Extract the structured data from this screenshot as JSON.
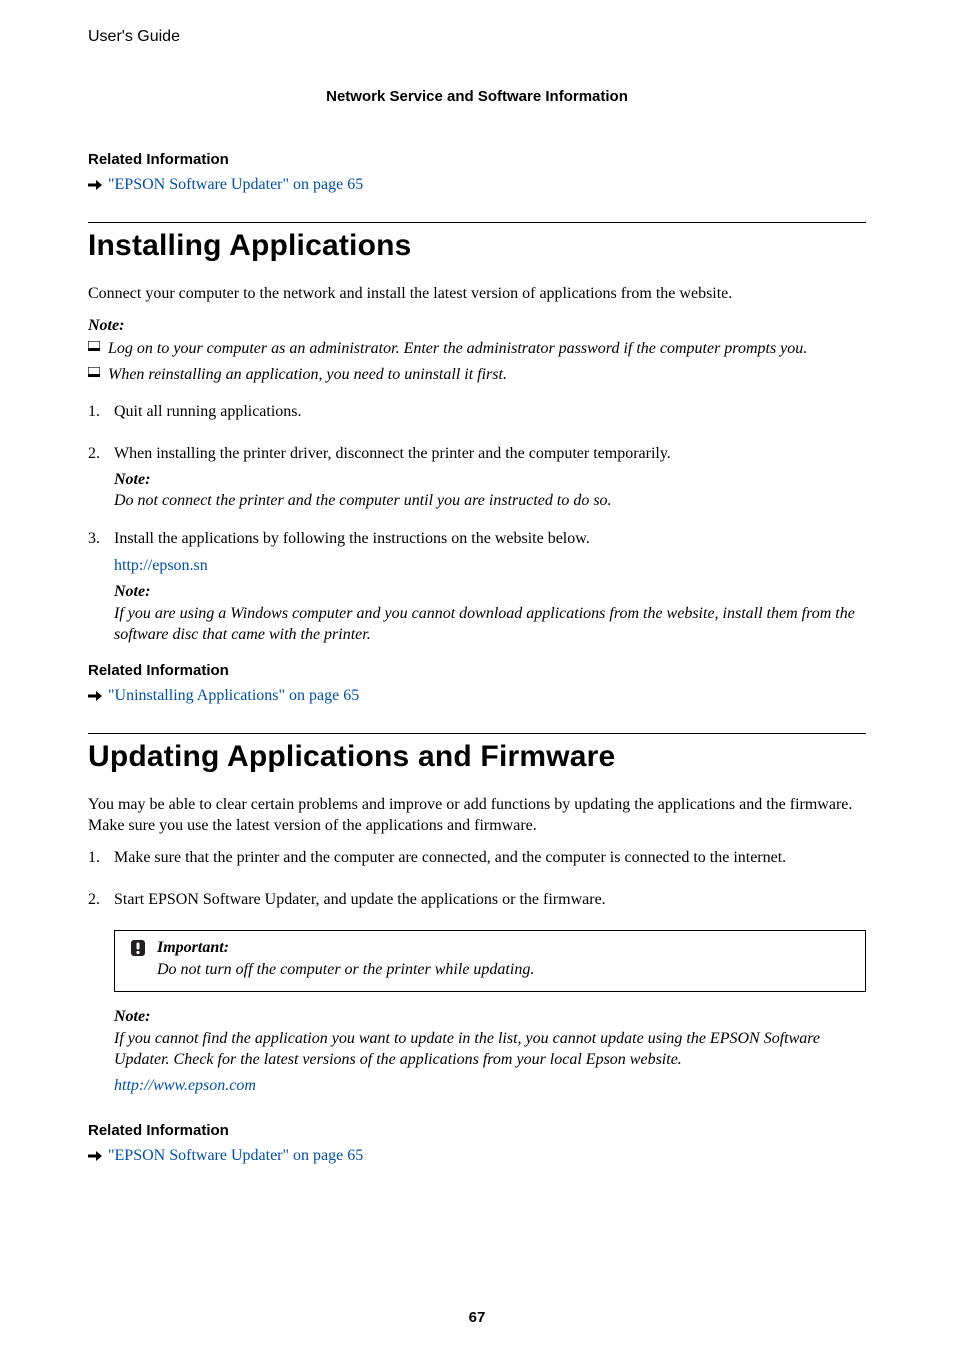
{
  "header": {
    "doc_type": "User's Guide",
    "chapter_title": "Network Service and Software Information"
  },
  "rel_info_label": "Related Information",
  "links": {
    "epson_updater": "\"EPSON Software Updater\" on page 65",
    "uninstalling": "\"Uninstalling Applications\" on page 65",
    "epson_sn": "http://epson.sn",
    "epson_com": "http://www.epson.com"
  },
  "section1": {
    "title": "Installing Applications",
    "intro": "Connect your computer to the network and install the latest version of applications from the website.",
    "note_label": "Note:",
    "bullets": [
      "Log on to your computer as an administrator. Enter the administrator password if the computer prompts you.",
      "When reinstalling an application, you need to uninstall it first."
    ],
    "steps": [
      {
        "text": "Quit all running applications."
      },
      {
        "text": "When installing the printer driver, disconnect the printer and the computer temporarily.",
        "note_label": "Note:",
        "note_body": "Do not connect the printer and the computer until you are instructed to do so."
      },
      {
        "text": "Install the applications by following the instructions on the website below.",
        "url_key": "epson_sn",
        "note_label": "Note:",
        "note_body": "If you are using a Windows computer and you cannot download applications from the website, install them from the software disc that came with the printer."
      }
    ]
  },
  "section2": {
    "title": "Updating Applications and Firmware",
    "intro": "You may be able to clear certain problems and improve or add functions by updating the applications and the firmware. Make sure you use the latest version of the applications and firmware.",
    "steps": [
      {
        "text": "Make sure that the printer and the computer are connected, and the computer is connected to the internet."
      },
      {
        "text": "Start EPSON Software Updater, and update the applications or the firmware."
      }
    ],
    "important_label": "Important:",
    "important_body": "Do not turn off the computer or the printer while updating.",
    "note_label": "Note:",
    "note_body": "If you cannot find the application you want to update in the list, you cannot update using the EPSON Software Updater. Check for the latest versions of the applications from your local Epson website."
  },
  "page_number": "67"
}
